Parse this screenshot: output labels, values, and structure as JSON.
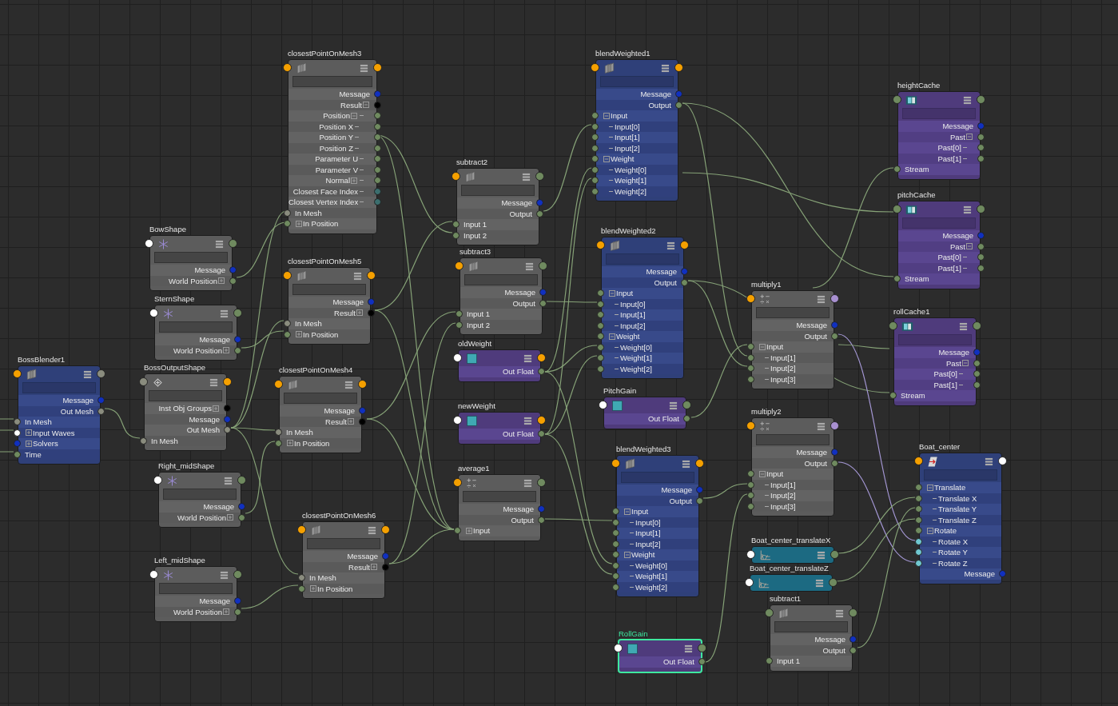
{
  "nodes": [
    {
      "name": "closestPointOnMesh3",
      "kind": "util",
      "selected": false,
      "in_port": {
        "color": "#f5a000"
      },
      "out_port": {
        "color": "#f5a000"
      },
      "rows": [
        {
          "label": "Message",
          "kind": "out",
          "color": "#1030c0"
        },
        {
          "label": "Result",
          "kind": "out",
          "color": "#000000",
          "expanded": true,
          "children": [
            {
              "label": "Position",
              "kind": "out",
              "color": "#6f8a5f",
              "expanded": true,
              "children": [
                {
                  "label": "Position X",
                  "kind": "out",
                  "color": "#6f8a5f"
                },
                {
                  "label": "Position Y",
                  "kind": "out",
                  "color": "#6f8a5f"
                },
                {
                  "label": "Position Z",
                  "kind": "out",
                  "color": "#6f8a5f"
                }
              ]
            },
            {
              "label": "Parameter U",
              "kind": "out",
              "color": "#6f8a5f"
            },
            {
              "label": "Parameter V",
              "kind": "out",
              "color": "#6f8a5f"
            },
            {
              "label": "Normal",
              "kind": "out",
              "color": "#6f8a5f",
              "expanded": false
            },
            {
              "label": "Closest Face Index",
              "kind": "out",
              "color": "#3b6e6e"
            },
            {
              "label": "Closest Vertex Index",
              "kind": "out",
              "color": "#3b6e6e"
            }
          ]
        },
        {
          "label": "In Mesh",
          "kind": "in",
          "color": "#8a8c7e"
        },
        {
          "label": "In Position",
          "kind": "in",
          "color": "#6f8a5f",
          "expanded": false
        }
      ]
    },
    {
      "name": "BowShape",
      "kind": "locator",
      "selected": false,
      "in_port": {
        "color": "#ffffff"
      },
      "out_port": {
        "color": "#6f8a5f"
      },
      "rows": [
        {
          "label": "Message",
          "kind": "out",
          "color": "#1030c0"
        },
        {
          "label": "World Position",
          "kind": "out",
          "color": "#6f8a5f",
          "expanded": false
        }
      ]
    },
    {
      "name": "SternShape",
      "kind": "locator",
      "selected": false,
      "in_port": {
        "color": "#ffffff"
      },
      "out_port": {
        "color": "#6f8a5f"
      },
      "rows": [
        {
          "label": "Message",
          "kind": "out",
          "color": "#1030c0"
        },
        {
          "label": "World Position",
          "kind": "out",
          "color": "#6f8a5f",
          "expanded": false
        }
      ]
    },
    {
      "name": "BossBlender1",
      "kind": "blender",
      "selected": false,
      "in_port": {
        "color": "#f5a000"
      },
      "out_port": {
        "color": "#8a8c7e"
      },
      "rows": [
        {
          "label": "Message",
          "kind": "out",
          "color": "#1030c0"
        },
        {
          "label": "Out Mesh",
          "kind": "out",
          "color": "#8a8c7e"
        },
        {
          "label": "In Mesh",
          "kind": "in",
          "color": "#8a8c7e"
        },
        {
          "label": "Input Waves",
          "kind": "in",
          "color": "#ffffff",
          "expanded": false
        },
        {
          "label": "Solvers",
          "kind": "in",
          "color": "#1030c0",
          "expanded": false
        },
        {
          "label": "Time",
          "kind": "in",
          "color": "#6f8a5f"
        }
      ]
    },
    {
      "name": "BossOutputShape",
      "kind": "mesh",
      "selected": false,
      "in_port": {
        "color": "#8a8c7e"
      },
      "out_port": {
        "color": "#f5a000"
      },
      "rows": [
        {
          "label": "Inst Obj Groups",
          "kind": "out",
          "color": "#000000",
          "expanded": false
        },
        {
          "label": "Message",
          "kind": "out",
          "color": "#1030c0"
        },
        {
          "label": "Out Mesh",
          "kind": "out",
          "color": "#8a8c7e"
        },
        {
          "label": "In Mesh",
          "kind": "in",
          "color": "#8a8c7e"
        }
      ]
    },
    {
      "name": "closestPointOnMesh5",
      "kind": "util",
      "selected": false,
      "in_port": {
        "color": "#f5a000"
      },
      "out_port": {
        "color": "#f5a000"
      },
      "rows": [
        {
          "label": "Message",
          "kind": "out",
          "color": "#1030c0"
        },
        {
          "label": "Result",
          "kind": "out",
          "color": "#000000",
          "expanded": false
        },
        {
          "label": "In Mesh",
          "kind": "in",
          "color": "#8a8c7e"
        },
        {
          "label": "In Position",
          "kind": "in",
          "color": "#6f8a5f",
          "expanded": false
        }
      ]
    },
    {
      "name": "closestPointOnMesh4",
      "kind": "util",
      "selected": false,
      "in_port": {
        "color": "#f5a000"
      },
      "out_port": {
        "color": "#f5a000"
      },
      "rows": [
        {
          "label": "Message",
          "kind": "out",
          "color": "#1030c0"
        },
        {
          "label": "Result",
          "kind": "out",
          "color": "#000000",
          "expanded": false
        },
        {
          "label": "In Mesh",
          "kind": "in",
          "color": "#8a8c7e"
        },
        {
          "label": "In Position",
          "kind": "in",
          "color": "#6f8a5f",
          "expanded": false
        }
      ]
    },
    {
      "name": "Right_midShape",
      "kind": "locator",
      "selected": false,
      "in_port": {
        "color": "#ffffff"
      },
      "out_port": {
        "color": "#6f8a5f"
      },
      "rows": [
        {
          "label": "Message",
          "kind": "out",
          "color": "#1030c0"
        },
        {
          "label": "World Position",
          "kind": "out",
          "color": "#6f8a5f",
          "expanded": false
        }
      ]
    },
    {
      "name": "Left_midShape",
      "kind": "locator",
      "selected": false,
      "in_port": {
        "color": "#ffffff"
      },
      "out_port": {
        "color": "#6f8a5f"
      },
      "rows": [
        {
          "label": "Message",
          "kind": "out",
          "color": "#1030c0"
        },
        {
          "label": "World Position",
          "kind": "out",
          "color": "#6f8a5f",
          "expanded": false
        }
      ]
    },
    {
      "name": "closestPointOnMesh6",
      "kind": "util",
      "selected": false,
      "in_port": {
        "color": "#f5a000"
      },
      "out_port": {
        "color": "#f5a000"
      },
      "rows": [
        {
          "label": "Message",
          "kind": "out",
          "color": "#1030c0"
        },
        {
          "label": "Result",
          "kind": "out",
          "color": "#000000",
          "expanded": false
        },
        {
          "label": "In Mesh",
          "kind": "in",
          "color": "#8a8c7e"
        },
        {
          "label": "In Position",
          "kind": "in",
          "color": "#6f8a5f",
          "expanded": false
        }
      ]
    },
    {
      "name": "subtract2",
      "kind": "util",
      "selected": false,
      "in_port": {
        "color": "#f5a000"
      },
      "out_port": {
        "color": "#6f8a5f"
      },
      "rows": [
        {
          "label": "Message",
          "kind": "out",
          "color": "#1030c0"
        },
        {
          "label": "Output",
          "kind": "out",
          "color": "#6f8a5f"
        },
        {
          "label": "Input 1",
          "kind": "in",
          "color": "#6f8a5f"
        },
        {
          "label": "Input 2",
          "kind": "in",
          "color": "#6f8a5f"
        }
      ]
    },
    {
      "name": "subtract3",
      "kind": "util",
      "selected": false,
      "in_port": {
        "color": "#f5a000"
      },
      "out_port": {
        "color": "#6f8a5f"
      },
      "rows": [
        {
          "label": "Message",
          "kind": "out",
          "color": "#1030c0"
        },
        {
          "label": "Output",
          "kind": "out",
          "color": "#6f8a5f"
        },
        {
          "label": "Input 1",
          "kind": "in",
          "color": "#6f8a5f"
        },
        {
          "label": "Input 2",
          "kind": "in",
          "color": "#6f8a5f"
        }
      ]
    },
    {
      "name": "oldWeight",
      "kind": "float",
      "selected": false,
      "in_port": {
        "color": "#ffffff"
      },
      "out_port": {
        "color": "#f5a000"
      },
      "rows": [
        {
          "label": "Out Float",
          "kind": "out",
          "color": "#6f8a5f"
        }
      ]
    },
    {
      "name": "newWeight",
      "kind": "float",
      "selected": false,
      "in_port": {
        "color": "#ffffff"
      },
      "out_port": {
        "color": "#f5a000"
      },
      "rows": [
        {
          "label": "Out Float",
          "kind": "out",
          "color": "#6f8a5f"
        }
      ]
    },
    {
      "name": "average1",
      "kind": "math",
      "selected": false,
      "in_port": {
        "color": "#f5a000"
      },
      "out_port": {
        "color": "#6f8a5f"
      },
      "rows": [
        {
          "label": "Message",
          "kind": "out",
          "color": "#1030c0"
        },
        {
          "label": "Output",
          "kind": "out",
          "color": "#6f8a5f"
        },
        {
          "label": "Input",
          "kind": "in",
          "color": "#6f8a5f",
          "expanded": false
        }
      ]
    },
    {
      "name": "blendWeighted1",
      "kind": "blend",
      "selected": false,
      "in_port": {
        "color": "#f5a000"
      },
      "out_port": {
        "color": "#f5a000"
      },
      "rows": [
        {
          "label": "Message",
          "kind": "out",
          "color": "#1030c0"
        },
        {
          "label": "Output",
          "kind": "out",
          "color": "#6f8a5f"
        },
        {
          "label": "Input",
          "kind": "in",
          "color": "#6f8a5f",
          "expanded": true,
          "children": [
            {
              "label": "Input[0]",
              "kind": "in",
              "color": "#6f8a5f"
            },
            {
              "label": "Input[1]",
              "kind": "in",
              "color": "#6f8a5f"
            },
            {
              "label": "Input[2]",
              "kind": "in",
              "color": "#6f8a5f"
            }
          ]
        },
        {
          "label": "Weight",
          "kind": "in",
          "color": "#6f8a5f",
          "expanded": true,
          "children": [
            {
              "label": "Weight[0]",
              "kind": "in",
              "color": "#6f8a5f"
            },
            {
              "label": "Weight[1]",
              "kind": "in",
              "color": "#6f8a5f"
            },
            {
              "label": "Weight[2]",
              "kind": "in",
              "color": "#6f8a5f"
            }
          ]
        }
      ]
    },
    {
      "name": "blendWeighted2",
      "kind": "blend",
      "selected": false,
      "in_port": {
        "color": "#f5a000"
      },
      "out_port": {
        "color": "#f5a000"
      },
      "rows": [
        {
          "label": "Message",
          "kind": "out",
          "color": "#1030c0"
        },
        {
          "label": "Output",
          "kind": "out",
          "color": "#6f8a5f"
        },
        {
          "label": "Input",
          "kind": "in",
          "color": "#6f8a5f",
          "expanded": true,
          "children": [
            {
              "label": "Input[0]",
              "kind": "in",
              "color": "#6f8a5f"
            },
            {
              "label": "Input[1]",
              "kind": "in",
              "color": "#6f8a5f"
            },
            {
              "label": "Input[2]",
              "kind": "in",
              "color": "#6f8a5f"
            }
          ]
        },
        {
          "label": "Weight",
          "kind": "in",
          "color": "#6f8a5f",
          "expanded": true,
          "children": [
            {
              "label": "Weight[0]",
              "kind": "in",
              "color": "#6f8a5f"
            },
            {
              "label": "Weight[1]",
              "kind": "in",
              "color": "#6f8a5f"
            },
            {
              "label": "Weight[2]",
              "kind": "in",
              "color": "#6f8a5f"
            }
          ]
        }
      ]
    },
    {
      "name": "PitchGain",
      "kind": "float",
      "selected": false,
      "in_port": {
        "color": "#ffffff"
      },
      "out_port": {
        "color": "#6f8a5f"
      },
      "rows": [
        {
          "label": "Out Float",
          "kind": "out",
          "color": "#6f8a5f"
        }
      ]
    },
    {
      "name": "blendWeighted3",
      "kind": "blend",
      "selected": false,
      "in_port": {
        "color": "#f5a000"
      },
      "out_port": {
        "color": "#f5a000"
      },
      "rows": [
        {
          "label": "Message",
          "kind": "out",
          "color": "#1030c0"
        },
        {
          "label": "Output",
          "kind": "out",
          "color": "#6f8a5f"
        },
        {
          "label": "Input",
          "kind": "in",
          "color": "#6f8a5f",
          "expanded": true,
          "children": [
            {
              "label": "Input[0]",
              "kind": "in",
              "color": "#6f8a5f"
            },
            {
              "label": "Input[1]",
              "kind": "in",
              "color": "#6f8a5f"
            },
            {
              "label": "Input[2]",
              "kind": "in",
              "color": "#6f8a5f"
            }
          ]
        },
        {
          "label": "Weight",
          "kind": "in",
          "color": "#6f8a5f",
          "expanded": true,
          "children": [
            {
              "label": "Weight[0]",
              "kind": "in",
              "color": "#6f8a5f"
            },
            {
              "label": "Weight[1]",
              "kind": "in",
              "color": "#6f8a5f"
            },
            {
              "label": "Weight[2]",
              "kind": "in",
              "color": "#6f8a5f"
            }
          ]
        }
      ]
    },
    {
      "name": "RollGain",
      "kind": "float",
      "selected": true,
      "in_port": {
        "color": "#ffffff"
      },
      "out_port": {
        "color": "#6f8a5f"
      },
      "rows": [
        {
          "label": "Out Float",
          "kind": "out",
          "color": "#6f8a5f"
        }
      ]
    },
    {
      "name": "heightCache",
      "kind": "cache",
      "selected": false,
      "in_port": {
        "color": "#6f8a5f"
      },
      "out_port": {
        "color": "#6f8a5f"
      },
      "rows": [
        {
          "label": "Message",
          "kind": "out",
          "color": "#1030c0"
        },
        {
          "label": "Past",
          "kind": "out",
          "color": "#6f8a5f",
          "expanded": true,
          "children": [
            {
              "label": "Past[0]",
              "kind": "out",
              "color": "#6f8a5f"
            },
            {
              "label": "Past[1]",
              "kind": "out",
              "color": "#6f8a5f"
            }
          ]
        },
        {
          "label": "Stream",
          "kind": "in",
          "color": "#6f8a5f"
        }
      ]
    },
    {
      "name": "pitchCache",
      "kind": "cache",
      "selected": false,
      "in_port": {
        "color": "#6f8a5f"
      },
      "out_port": {
        "color": "#6f8a5f"
      },
      "rows": [
        {
          "label": "Message",
          "kind": "out",
          "color": "#1030c0"
        },
        {
          "label": "Past",
          "kind": "out",
          "color": "#6f8a5f",
          "expanded": true,
          "children": [
            {
              "label": "Past[0]",
              "kind": "out",
              "color": "#6f8a5f"
            },
            {
              "label": "Past[1]",
              "kind": "out",
              "color": "#6f8a5f"
            }
          ]
        },
        {
          "label": "Stream",
          "kind": "in",
          "color": "#6f8a5f"
        }
      ]
    },
    {
      "name": "multiply1",
      "kind": "math",
      "selected": false,
      "in_port": {
        "color": "#f5a000"
      },
      "out_port": {
        "color": "#a890d0"
      },
      "rows": [
        {
          "label": "Message",
          "kind": "out",
          "color": "#1030c0"
        },
        {
          "label": "Output",
          "kind": "out",
          "color": "#6f8a5f"
        },
        {
          "label": "Input",
          "kind": "in",
          "color": "#6f8a5f",
          "expanded": true,
          "children": [
            {
              "label": "Input[1]",
              "kind": "in",
              "color": "#6f8a5f"
            },
            {
              "label": "Input[2]",
              "kind": "in",
              "color": "#6f8a5f"
            },
            {
              "label": "Input[3]",
              "kind": "in",
              "color": "#6f8a5f"
            }
          ]
        }
      ]
    },
    {
      "name": "rollCache1",
      "kind": "cache",
      "selected": false,
      "in_port": {
        "color": "#6f8a5f"
      },
      "out_port": {
        "color": "#6f8a5f"
      },
      "rows": [
        {
          "label": "Message",
          "kind": "out",
          "color": "#1030c0"
        },
        {
          "label": "Past",
          "kind": "out",
          "color": "#6f8a5f",
          "expanded": true,
          "children": [
            {
              "label": "Past[0]",
              "kind": "out",
              "color": "#6f8a5f"
            },
            {
              "label": "Past[1]",
              "kind": "out",
              "color": "#6f8a5f"
            }
          ]
        },
        {
          "label": "Stream",
          "kind": "in",
          "color": "#6f8a5f"
        }
      ]
    },
    {
      "name": "multiply2",
      "kind": "math",
      "selected": false,
      "in_port": {
        "color": "#f5a000"
      },
      "out_port": {
        "color": "#a890d0"
      },
      "rows": [
        {
          "label": "Message",
          "kind": "out",
          "color": "#1030c0"
        },
        {
          "label": "Output",
          "kind": "out",
          "color": "#6f8a5f"
        },
        {
          "label": "Input",
          "kind": "in",
          "color": "#6f8a5f",
          "expanded": true,
          "children": [
            {
              "label": "Input[1]",
              "kind": "in",
              "color": "#6f8a5f"
            },
            {
              "label": "Input[2]",
              "kind": "in",
              "color": "#6f8a5f"
            },
            {
              "label": "Input[3]",
              "kind": "in",
              "color": "#6f8a5f"
            }
          ]
        }
      ]
    },
    {
      "name": "Boat_center_translateX",
      "kind": "curve",
      "selected": false,
      "in_port": {
        "color": "#ffffff"
      },
      "out_port": {
        "color": "#6f8a5f"
      }
    },
    {
      "name": "Boat_center_translateZ",
      "kind": "curve",
      "selected": false,
      "in_port": {
        "color": "#ffffff"
      },
      "out_port": {
        "color": "#6f8a5f"
      }
    },
    {
      "name": "subtract1",
      "kind": "util",
      "selected": false,
      "in_port": {
        "color": "#6f8a5f"
      },
      "out_port": {
        "color": "#6f8a5f"
      },
      "rows": [
        {
          "label": "Message",
          "kind": "out",
          "color": "#1030c0"
        },
        {
          "label": "Output",
          "kind": "out",
          "color": "#6f8a5f"
        },
        {
          "label": "Input 1",
          "kind": "in",
          "color": "#6f8a5f"
        }
      ]
    },
    {
      "name": "Boat_center",
      "kind": "transform",
      "selected": false,
      "in_port": {
        "color": "#f5a000"
      },
      "out_port": {
        "color": "#ffffff"
      },
      "rows": [
        {
          "label": "Translate",
          "kind": "in",
          "color": "#6f8a5f",
          "expanded": true,
          "children": [
            {
              "label": "Translate X",
              "kind": "in",
              "color": "#6f8a5f"
            },
            {
              "label": "Translate Y",
              "kind": "in",
              "color": "#6f8a5f"
            },
            {
              "label": "Translate Z",
              "kind": "in",
              "color": "#6f8a5f"
            }
          ]
        },
        {
          "label": "Rotate",
          "kind": "in",
          "color": "#6f8a5f",
          "expanded": true,
          "children": [
            {
              "label": "Rotate X",
              "kind": "in",
              "color": "#70c8d0"
            },
            {
              "label": "Rotate Y",
              "kind": "in",
              "color": "#70c8d0"
            },
            {
              "label": "Rotate Z",
              "kind": "in",
              "color": "#70c8d0"
            }
          ]
        },
        {
          "label": "Message",
          "kind": "out",
          "color": "#1030c0"
        }
      ]
    }
  ]
}
